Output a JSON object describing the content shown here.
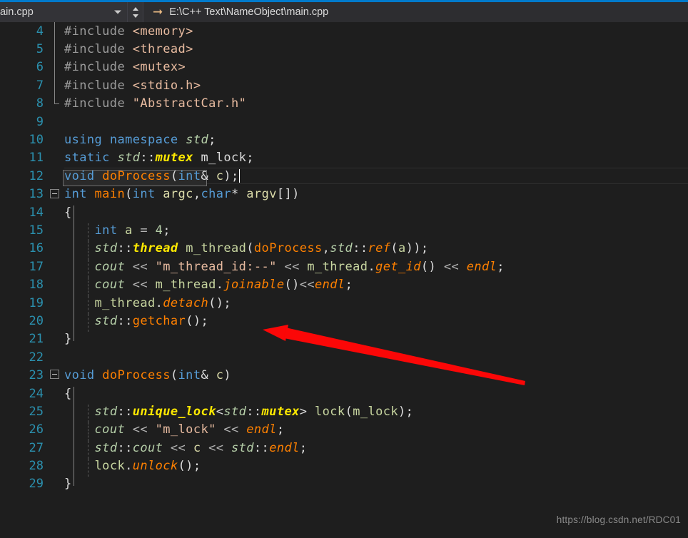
{
  "topbar": {
    "tab_label": "ain.cpp",
    "dropdown_icon": "chevron-down-icon",
    "spinner_up_icon": "triangle-up-icon",
    "spinner_down_icon": "triangle-down-icon",
    "path_icon": "arrow-right-icon",
    "path_text": "E:\\C++ Text\\NameObject\\main.cpp"
  },
  "editor": {
    "first_line_number": 4,
    "last_line_number": 29,
    "lines": [
      {
        "n": "4",
        "fold": "line",
        "guide": false
      },
      {
        "n": "5",
        "fold": "line",
        "guide": false
      },
      {
        "n": "6",
        "fold": "line",
        "guide": false
      },
      {
        "n": "7",
        "fold": "line",
        "guide": false
      },
      {
        "n": "8",
        "fold": "foot",
        "guide": false
      },
      {
        "n": "9",
        "fold": "none",
        "guide": false
      },
      {
        "n": "10",
        "fold": "none",
        "guide": false
      },
      {
        "n": "11",
        "fold": "none",
        "guide": false
      },
      {
        "n": "12",
        "fold": "none",
        "guide": false
      },
      {
        "n": "13",
        "fold": "box",
        "guide": false
      },
      {
        "n": "14",
        "fold": "line",
        "guide": false
      },
      {
        "n": "15",
        "fold": "line",
        "guide": true
      },
      {
        "n": "16",
        "fold": "line",
        "guide": true
      },
      {
        "n": "17",
        "fold": "line",
        "guide": true
      },
      {
        "n": "18",
        "fold": "line",
        "guide": true
      },
      {
        "n": "19",
        "fold": "line",
        "guide": true
      },
      {
        "n": "20",
        "fold": "line",
        "guide": true
      },
      {
        "n": "21",
        "fold": "foot",
        "guide": false
      },
      {
        "n": "22",
        "fold": "none",
        "guide": false
      },
      {
        "n": "23",
        "fold": "box",
        "guide": false
      },
      {
        "n": "24",
        "fold": "line",
        "guide": false
      },
      {
        "n": "25",
        "fold": "line",
        "guide": true
      },
      {
        "n": "26",
        "fold": "line",
        "guide": true
      },
      {
        "n": "27",
        "fold": "line",
        "guide": true
      },
      {
        "n": "28",
        "fold": "line",
        "guide": true
      },
      {
        "n": "29",
        "fold": "foot",
        "guide": false
      }
    ],
    "code_text": {
      "l4": "#include <memory>",
      "l5": "#include <thread>",
      "l6": "#include <mutex>",
      "l7": "#include <stdio.h>",
      "l8": "#include \"AbstractCar.h\"",
      "l9": "",
      "l10": "using namespace std;",
      "l11": "static std::mutex m_lock;",
      "l12": "void doProcess(int& c);",
      "l13": "int main(int argc,char* argv[])",
      "l14": "{",
      "l15": "    int a = 4;",
      "l16": "    std::thread m_thread(doProcess,std::ref(a));",
      "l17": "    cout << \"m_thread_id:--\" << m_thread.get_id() << endl;",
      "l18": "    cout << m_thread.joinable()<<endl;",
      "l19": "    m_thread.detach();",
      "l20": "    std::getchar();",
      "l21": "}",
      "l22": "",
      "l23": "void doProcess(int& c)",
      "l24": "{",
      "l25": "    std::unique_lock<std::mutex> lock(m_lock);",
      "l26": "    cout << \"m_lock\" << endl;",
      "l27": "    std::cout << c << std::endl;",
      "l28": "    lock.unlock();",
      "l29": "}"
    },
    "tokens": {
      "include_kw": "#include",
      "memory_inc": "<memory>",
      "thread_inc": "<thread>",
      "mutex_inc": "<mutex>",
      "stdio_inc": "<stdio.h>",
      "abstractcar_inc": "\"AbstractCar.h\"",
      "using": "using",
      "namespace": "namespace",
      "std": "std",
      "static": "static",
      "mutex_type": "mutex",
      "m_lock_var": "m_lock",
      "void": "void",
      "doProcess": "doProcess",
      "int": "int",
      "c_param": "c",
      "main": "main",
      "argc": "argc",
      "char": "char",
      "argv": "argv",
      "a_var": "a",
      "four": "4",
      "thread_type": "thread",
      "m_thread": "m_thread",
      "ref": "ref",
      "cout": "cout",
      "thread_id_string": "\"m_thread_id:--\"",
      "get_id": "get_id",
      "endl": "endl",
      "joinable": "joinable",
      "detach": "detach",
      "getchar": "getchar",
      "unique_lock": "unique_lock",
      "lock_var": "lock",
      "m_lock_string": "\"m_lock\"",
      "unlock": "unlock"
    }
  },
  "annotation": {
    "arrow_color": "#fb0707",
    "arrow_name": "red-pointer-arrow",
    "points_to_line": "19"
  },
  "watermark": {
    "text": "https://blog.csdn.net/RDC01"
  },
  "colors": {
    "editor_background": "#1e1e1e",
    "topbar_background": "#2d2d30",
    "accent_blue": "#007acc",
    "line_number": "#2b91af",
    "keyword": "#569cd6",
    "function": "#ff8000",
    "type": "#ffe900",
    "namespace": "#b5cea8",
    "string": "#e8bba0",
    "preprocessor": "#9b9b9b",
    "default_text": "#dcdcdc"
  }
}
